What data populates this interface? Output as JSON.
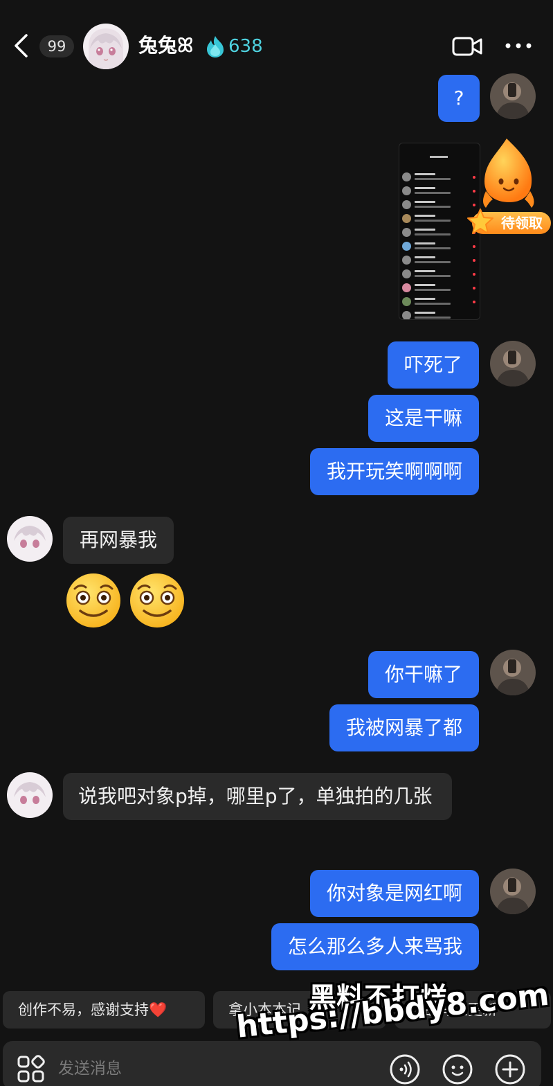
{
  "header": {
    "unread_count": "99",
    "contact_name": "兔兔ꕤ",
    "streak_count": "638"
  },
  "messages": [
    {
      "from": "me",
      "text": "?"
    },
    {
      "from": "me",
      "type": "image"
    },
    {
      "from": "me",
      "text": "吓死了"
    },
    {
      "from": "me",
      "text": "这是干嘛"
    },
    {
      "from": "me",
      "text": "我开玩笑啊啊啊"
    },
    {
      "from": "them",
      "text": "再网暴我"
    },
    {
      "from": "them",
      "type": "emoji",
      "emoji": "smiling-face-icon x2"
    },
    {
      "from": "me",
      "text": "你干嘛了"
    },
    {
      "from": "me",
      "text": "我被网暴了都"
    },
    {
      "from": "them",
      "text": "说我吧对象p掉，哪里p了，单独拍的几张"
    },
    {
      "from": "me",
      "text": "你对象是网红啊"
    },
    {
      "from": "me",
      "text": "怎么那么多人来骂我"
    }
  ],
  "reward_widget": {
    "label": "待领取"
  },
  "quick_replies": [
    {
      "label": "创作不易，感谢支持",
      "heart": "❤️"
    },
    {
      "label": "拿小本本记"
    },
    {
      "label": "作品马上更新"
    }
  ],
  "input": {
    "placeholder": "发送消息"
  },
  "watermark": {
    "line1": "黑料不打烊",
    "line2": "https://bbdy8.com"
  },
  "colors": {
    "background": "#131313",
    "my_bubble": "#2c6cf1",
    "their_bubble": "#2a2a2a",
    "streak": "#4fd3e0"
  }
}
